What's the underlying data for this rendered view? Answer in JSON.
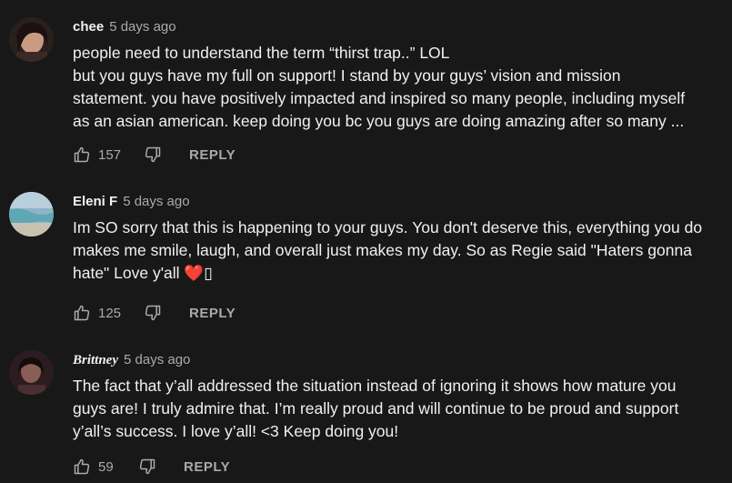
{
  "comments": [
    {
      "author": "chee",
      "time": "5 days ago",
      "lines": [
        "people need to understand the term “thirst trap..” LOL",
        "but you guys have my full on support! I stand by your guys’ vision and mission",
        "statement. you have positively impacted and inspired so many people, including myself",
        "as an asian american. keep doing you bc you guys are doing amazing after so many ..."
      ],
      "likes": "157",
      "reply_label": "REPLY",
      "avatar_icon": "avatar-photo"
    },
    {
      "author": "Eleni F",
      "time": "5 days ago",
      "lines": [
        "Im SO sorry that this is happening to your guys. You don't deserve this, everything you do",
        "makes me smile, laugh, and overall just makes my day. So as Regie said \"Haters gonna",
        "hate\"  Love y'all"
      ],
      "emoji": "❤️",
      "missing_glyph": "▯",
      "likes": "125",
      "reply_label": "REPLY",
      "avatar_icon": "avatar-photo"
    },
    {
      "author": "Brittney",
      "time": "5 days ago",
      "lines": [
        "The fact that y’all addressed the situation instead of ignoring it shows how mature you",
        "guys are! I truly admire that. I’m really proud and will continue to be proud and support",
        "y’all’s success. I love y’all! <3 Keep doing you!"
      ],
      "likes": "59",
      "reply_label": "REPLY",
      "avatar_icon": "avatar-photo"
    }
  ],
  "colors": {
    "background": "#181818",
    "text": "#f1f1f1",
    "muted": "#aaaaaa",
    "heart": "#e0245e"
  },
  "icons": {
    "like": "thumbs-up-icon",
    "dislike": "thumbs-down-icon"
  }
}
